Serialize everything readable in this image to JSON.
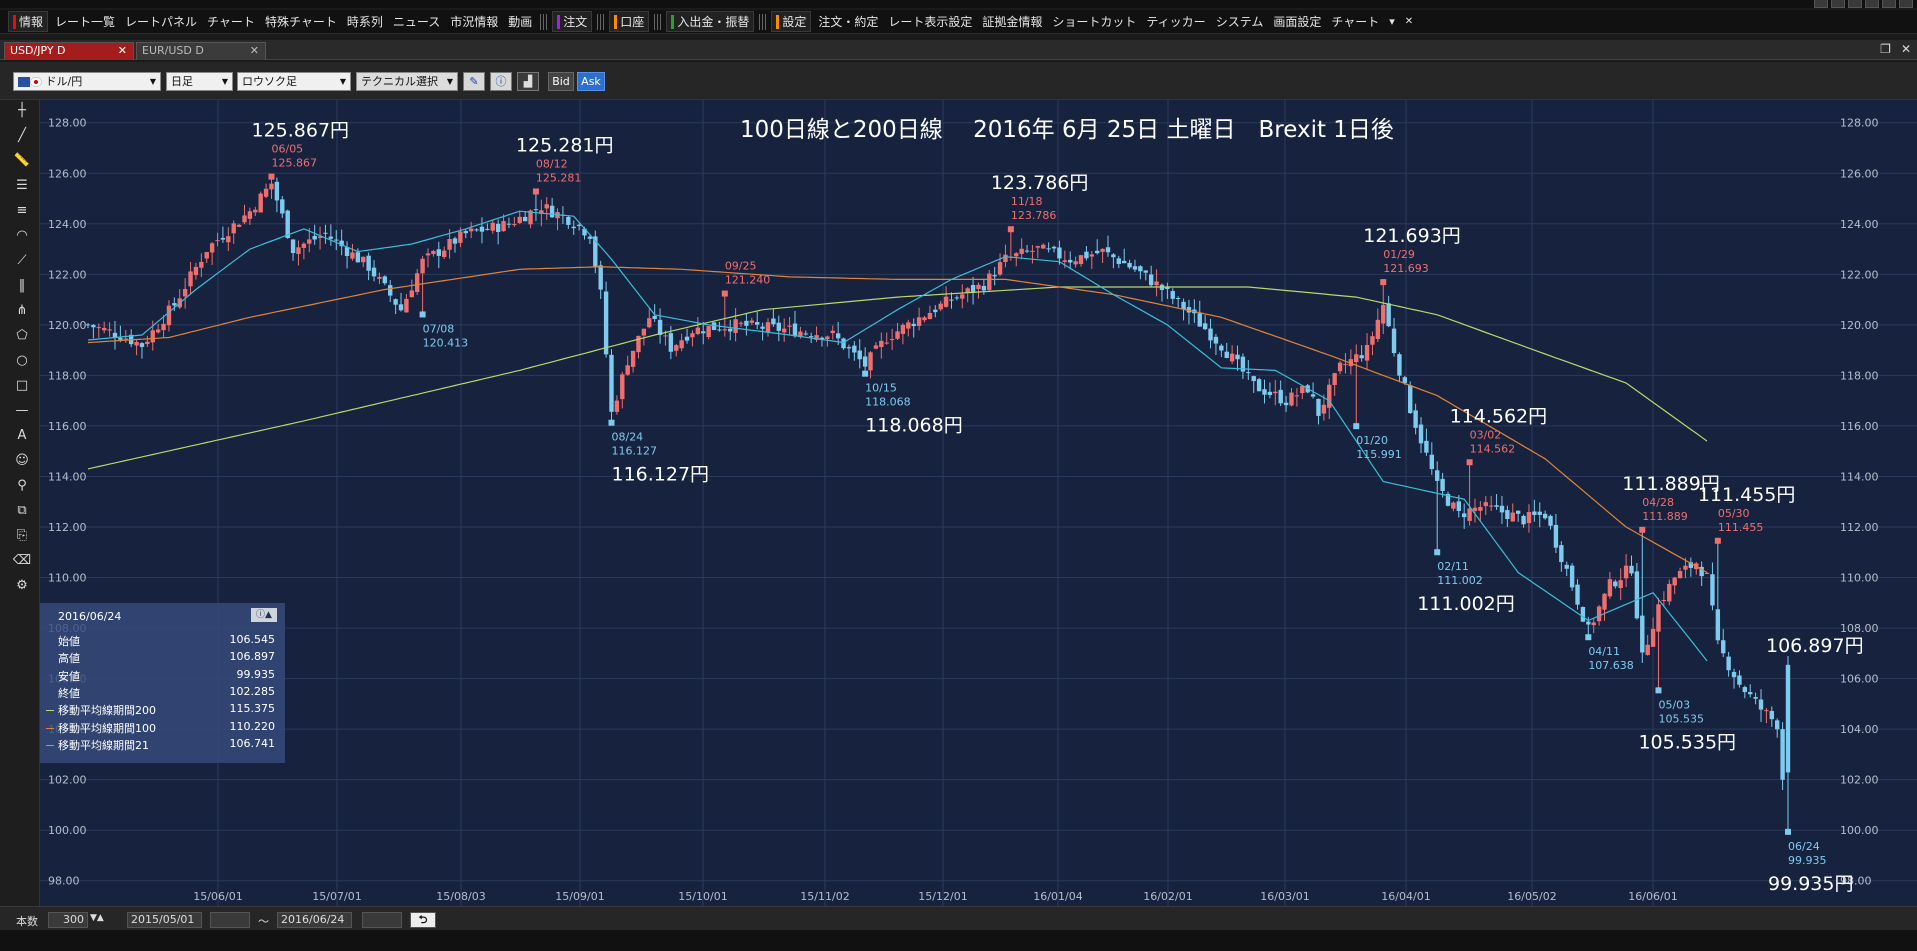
{
  "menu": {
    "items": [
      {
        "label": "情報",
        "bar": "#d11",
        "group": true
      },
      {
        "label": "レート一覧"
      },
      {
        "label": "レートパネル"
      },
      {
        "label": "チャート"
      },
      {
        "label": "特殊チャート"
      },
      {
        "label": "時系列"
      },
      {
        "label": "ニュース"
      },
      {
        "label": "市況情報"
      },
      {
        "label": "動画"
      },
      {
        "label": "注文",
        "bar": "#a020f0",
        "group": true
      },
      {
        "label": "口座",
        "bar": "#ff8c00",
        "group": true
      },
      {
        "label": "入出金・振替",
        "bar": "#2ca02c",
        "group": true
      },
      {
        "label": "設定",
        "bar": "#ff8c00",
        "group": true
      },
      {
        "label": "注文・約定"
      },
      {
        "label": "レート表示設定"
      },
      {
        "label": "証拠金情報"
      },
      {
        "label": "ショートカット"
      },
      {
        "label": "ティッカー"
      },
      {
        "label": "システム"
      },
      {
        "label": "画面設定"
      },
      {
        "label": "チャート"
      }
    ]
  },
  "tabs": [
    {
      "label": "USD/JPY D"
    },
    {
      "label": "EUR/USD D"
    }
  ],
  "toolbar": {
    "pair": "ドル/円",
    "timeframe": "日足",
    "charttype": "ロウソク足",
    "technical": "テクニカル選択",
    "bid": "Bid",
    "ask": "Ask"
  },
  "bottom": {
    "count_label": "本数",
    "count": "300",
    "from": "2015/05/01",
    "tilde": "～",
    "to": "2016/06/24"
  },
  "infopanel": {
    "date": "2016/06/24",
    "rows": [
      {
        "k": "始値",
        "v": "106.545",
        "color": ""
      },
      {
        "k": "高値",
        "v": "106.897",
        "color": ""
      },
      {
        "k": "安値",
        "v": "99.935",
        "color": ""
      },
      {
        "k": "終値",
        "v": "102.285",
        "color": ""
      },
      {
        "k": "移動平均線期間200",
        "v": "115.375",
        "color": "#b6d96a"
      },
      {
        "k": "移動平均線期間100",
        "v": "110.220",
        "color": "#e0843a"
      },
      {
        "k": "移動平均線期間21",
        "v": "106.741",
        "color": "#3bbfd9"
      }
    ]
  },
  "colors": {
    "up": "#ef6f6f",
    "down": "#7ecbf0",
    "ma21": "#3bbfd9",
    "ma100": "#e0843a",
    "ma200": "#b6d96a"
  },
  "chart_data": {
    "type": "line",
    "title": "100日線と200日線　 2016年 6月 25日 土曜日　Brexit 1日後",
    "ylim": [
      97,
      128.9
    ],
    "yticks": [
      "128.00",
      "126.00",
      "124.00",
      "122.00",
      "120.00",
      "118.00",
      "116.00",
      "114.00",
      "112.00",
      "110.00",
      "108.00",
      "106.00",
      "104.00",
      "102.00",
      "100.00",
      "98.00"
    ],
    "xticks": [
      "15/06/01",
      "15/07/01",
      "15/08/03",
      "15/09/01",
      "15/10/01",
      "15/11/02",
      "15/12/01",
      "16/01/04",
      "16/02/01",
      "16/03/01",
      "16/04/01",
      "16/05/02",
      "16/06/01"
    ],
    "series": [
      {
        "name": "移動平均線期間200",
        "key": "ma200",
        "values": [
          [
            0,
            114.3
          ],
          [
            40,
            116.2
          ],
          [
            80,
            118.2
          ],
          [
            105,
            119.6
          ],
          [
            125,
            120.6
          ],
          [
            150,
            121.1
          ],
          [
            180,
            121.5
          ],
          [
            215,
            121.5
          ],
          [
            235,
            121.1
          ],
          [
            250,
            120.4
          ],
          [
            268,
            119.0
          ],
          [
            285,
            117.7
          ],
          [
            300,
            115.4
          ]
        ]
      },
      {
        "name": "移動平均線期間100",
        "key": "ma100",
        "values": [
          [
            0,
            119.3
          ],
          [
            15,
            119.5
          ],
          [
            30,
            120.3
          ],
          [
            55,
            121.4
          ],
          [
            80,
            122.2
          ],
          [
            95,
            122.3
          ],
          [
            110,
            122.2
          ],
          [
            130,
            121.9
          ],
          [
            150,
            121.8
          ],
          [
            170,
            121.8
          ],
          [
            190,
            121.2
          ],
          [
            210,
            120.3
          ],
          [
            230,
            118.8
          ],
          [
            250,
            117.2
          ],
          [
            270,
            114.7
          ],
          [
            285,
            112.0
          ],
          [
            300,
            110.2
          ]
        ]
      },
      {
        "name": "移動平均線期間21",
        "key": "ma21",
        "values": [
          [
            0,
            119.4
          ],
          [
            10,
            119.6
          ],
          [
            20,
            121.4
          ],
          [
            30,
            123.0
          ],
          [
            40,
            123.8
          ],
          [
            50,
            122.9
          ],
          [
            60,
            123.2
          ],
          [
            70,
            123.8
          ],
          [
            80,
            124.5
          ],
          [
            90,
            124.3
          ],
          [
            97,
            122.6
          ],
          [
            105,
            120.4
          ],
          [
            115,
            120.0
          ],
          [
            130,
            119.6
          ],
          [
            140,
            119.3
          ],
          [
            150,
            120.6
          ],
          [
            160,
            121.8
          ],
          [
            170,
            122.7
          ],
          [
            180,
            122.5
          ],
          [
            190,
            121.2
          ],
          [
            200,
            120.0
          ],
          [
            210,
            118.3
          ],
          [
            220,
            118.2
          ],
          [
            230,
            117.0
          ],
          [
            240,
            113.8
          ],
          [
            255,
            113.1
          ],
          [
            265,
            110.2
          ],
          [
            278,
            108.3
          ],
          [
            290,
            109.4
          ],
          [
            300,
            106.7
          ]
        ]
      }
    ],
    "path": [
      [
        0,
        120.0
      ],
      [
        6,
        119.6
      ],
      [
        10,
        119.2
      ],
      [
        16,
        120.8
      ],
      [
        22,
        123.0
      ],
      [
        30,
        124.5
      ],
      [
        34,
        125.6
      ],
      [
        38,
        123.0
      ],
      [
        44,
        123.6
      ],
      [
        52,
        122.3
      ],
      [
        58,
        120.6
      ],
      [
        62,
        122.5
      ],
      [
        70,
        123.6
      ],
      [
        78,
        124.0
      ],
      [
        84,
        124.7
      ],
      [
        89,
        124.2
      ],
      [
        93,
        123.6
      ],
      [
        95,
        121.2
      ],
      [
        97,
        116.5
      ],
      [
        100,
        118.6
      ],
      [
        104,
        120.3
      ],
      [
        108,
        119.1
      ],
      [
        112,
        119.8
      ],
      [
        120,
        120.0
      ],
      [
        130,
        119.8
      ],
      [
        138,
        119.6
      ],
      [
        144,
        118.4
      ],
      [
        148,
        119.5
      ],
      [
        155,
        120.4
      ],
      [
        160,
        121.0
      ],
      [
        166,
        121.6
      ],
      [
        170,
        122.6
      ],
      [
        176,
        123.0
      ],
      [
        182,
        122.6
      ],
      [
        188,
        122.9
      ],
      [
        194,
        122.2
      ],
      [
        198,
        121.6
      ],
      [
        204,
        120.5
      ],
      [
        210,
        119.2
      ],
      [
        216,
        117.6
      ],
      [
        222,
        117.0
      ],
      [
        226,
        117.5
      ],
      [
        228,
        116.5
      ],
      [
        232,
        118.3
      ],
      [
        237,
        119.0
      ],
      [
        240,
        120.8
      ],
      [
        242,
        119.0
      ],
      [
        245,
        116.7
      ],
      [
        250,
        113.6
      ],
      [
        254,
        112.5
      ],
      [
        258,
        112.8
      ],
      [
        262,
        112.6
      ],
      [
        266,
        112.3
      ],
      [
        270,
        112.5
      ],
      [
        274,
        110.3
      ],
      [
        278,
        107.9
      ],
      [
        282,
        109.7
      ],
      [
        286,
        110.4
      ],
      [
        288,
        106.8
      ],
      [
        291,
        108.9
      ],
      [
        294,
        110.0
      ],
      [
        298,
        110.6
      ],
      [
        300,
        110.0
      ],
      [
        302,
        107.3
      ],
      [
        306,
        105.8
      ],
      [
        310,
        104.8
      ],
      [
        313,
        104.2
      ],
      [
        315,
        99.935
      ]
    ],
    "swings": [
      {
        "x": 34,
        "v": 125.867,
        "date": "06/05",
        "big": "125.867円",
        "high": true,
        "bigdx": 0,
        "bigy": 125
      },
      {
        "x": 62,
        "v": 120.413,
        "date": "07/08",
        "big": "",
        "high": false,
        "bigdx": 0,
        "bigy": 0
      },
      {
        "x": 83,
        "v": 125.281,
        "date": "08/12",
        "big": "125.281円",
        "high": true,
        "bigdx": 0,
        "bigy": 0
      },
      {
        "x": 97,
        "v": 116.127,
        "date": "08/24",
        "big": "116.127円",
        "high": false,
        "bigdx": 20,
        "bigy": 0
      },
      {
        "x": 118,
        "v": 121.24,
        "date": "09/25",
        "big": "",
        "high": true,
        "bigdx": 0,
        "bigy": 0
      },
      {
        "x": 144,
        "v": 118.068,
        "date": "10/15",
        "big": "118.068円",
        "high": false,
        "bigdx": 20,
        "bigy": 0
      },
      {
        "x": 171,
        "v": 123.786,
        "date": "11/18",
        "big": "123.786円",
        "high": true,
        "bigdx": 0,
        "bigy": 0
      },
      {
        "x": 235,
        "v": 115.991,
        "date": "01/20",
        "big": "",
        "high": false,
        "bigdx": 0,
        "bigy": 0
      },
      {
        "x": 240,
        "v": 121.693,
        "date": "01/29",
        "big": "121.693円",
        "high": true,
        "bigdx": 0,
        "bigy": 0
      },
      {
        "x": 256,
        "v": 114.562,
        "date": "03/02",
        "big": "114.562円",
        "high": true,
        "bigdx": 0,
        "bigy": 0
      },
      {
        "x": 250,
        "v": 111.002,
        "date": "02/11",
        "big": "111.002円",
        "high": false,
        "bigdx": 0,
        "bigy": 0
      },
      {
        "x": 278,
        "v": 107.638,
        "date": "04/11",
        "big": "",
        "high": false,
        "bigdx": 0,
        "bigy": 0
      },
      {
        "x": 288,
        "v": 111.889,
        "date": "04/28",
        "big": "111.889円",
        "high": true,
        "bigdx": 0,
        "bigy": 0
      },
      {
        "x": 291,
        "v": 105.535,
        "date": "05/03",
        "big": "105.535円",
        "high": false,
        "bigdx": 0,
        "bigy": 0
      },
      {
        "x": 302,
        "v": 111.455,
        "date": "05/30",
        "big": "111.455円",
        "high": true,
        "bigdx": 0,
        "bigy": 0
      },
      {
        "x": 315,
        "v": 99.935,
        "date": "06/24",
        "big": "99.935円",
        "high": false,
        "bigdx": 0,
        "bigy": 0
      }
    ],
    "extra_labels": [
      {
        "x": 315,
        "v": 106.897,
        "text": "106.897円"
      }
    ]
  }
}
